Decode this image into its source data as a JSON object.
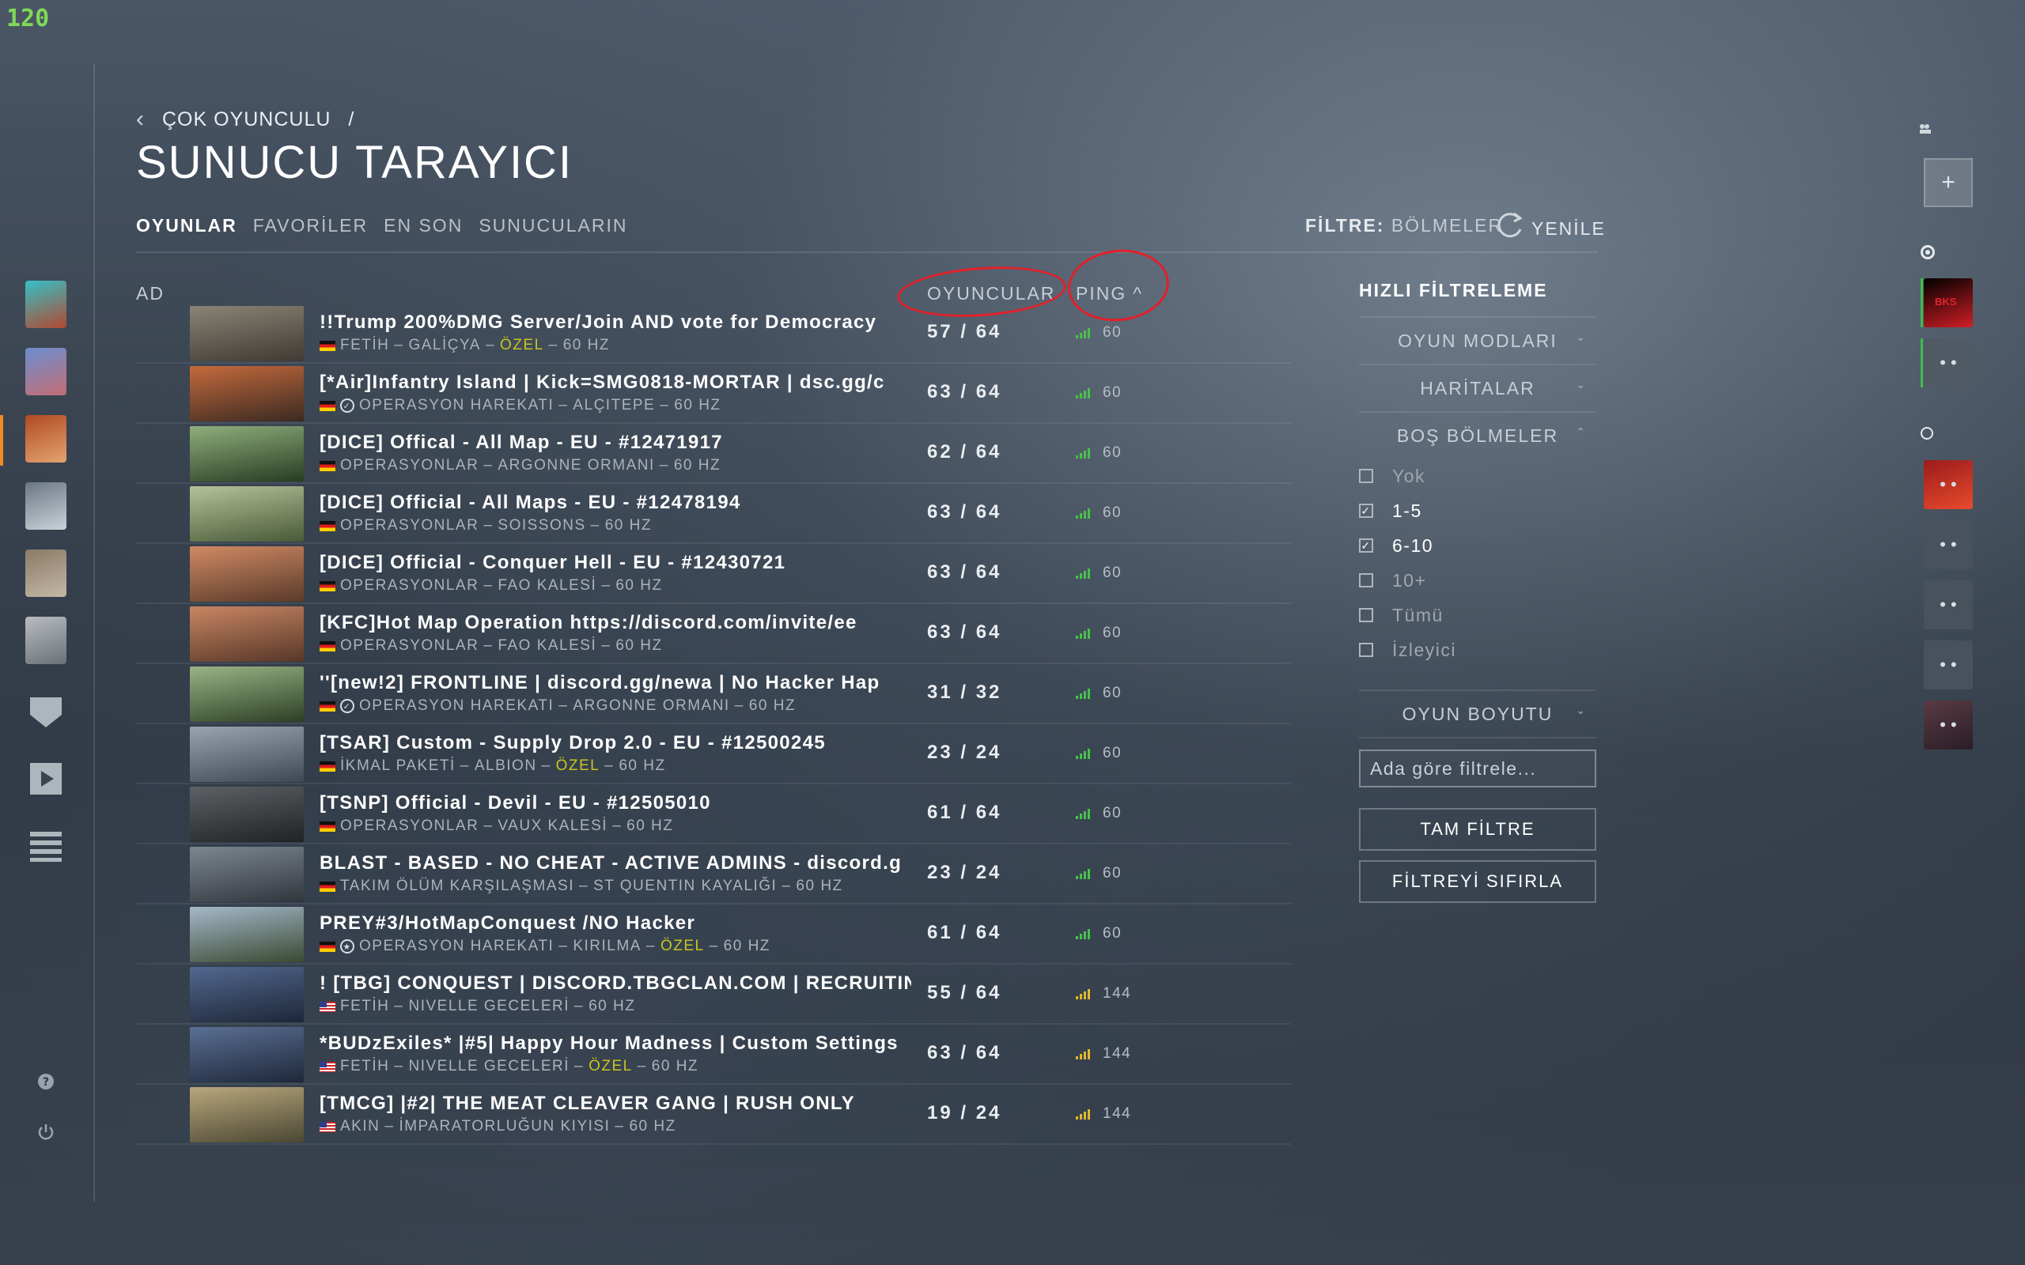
{
  "fps_counter": "120",
  "breadcrumb": {
    "parent": "ÇOK OYUNCULU",
    "separator": "/"
  },
  "page_title": "SUNUCU TARAYICI",
  "tabs": [
    "OYUNLAR",
    "FAVORİLER",
    "EN SON",
    "SUNUCULARIN"
  ],
  "filter": {
    "label": "FİLTRE:",
    "value": "BÖLMELER"
  },
  "refresh_label": "YENİLE",
  "columns": {
    "name": "AD",
    "players": "OYUNCULAR",
    "ping": "PING"
  },
  "servers": [
    {
      "name": "!!Trump 200%DMG Server/Join AND vote for Democracy",
      "flag": "de",
      "icon": "",
      "mode": "FETİH",
      "map": "GALİÇYA",
      "custom": "ÖZEL",
      "hz": "60 HZ",
      "players": "57 / 64",
      "ping": "60",
      "signal": "green",
      "colors": [
        "#8a8476",
        "#3f3a33"
      ]
    },
    {
      "name": "[*Air]Infantry Island | Kick=SMG0818-MORTAR | dsc.gg/c",
      "flag": "de",
      "icon": "check",
      "mode": "OPERASYON HAREKATI",
      "map": "ALÇITEPE",
      "custom": "",
      "hz": "60 HZ",
      "players": "63 / 64",
      "ping": "60",
      "signal": "green",
      "colors": [
        "#c46a3c",
        "#3b2a22"
      ]
    },
    {
      "name": "[DICE] Offical - All Map - EU - #12471917",
      "flag": "de",
      "icon": "",
      "mode": "OPERASYONLAR",
      "map": "ARGONNE ORMANI",
      "custom": "",
      "hz": "60 HZ",
      "players": "62 / 64",
      "ping": "60",
      "signal": "green",
      "colors": [
        "#8fae7d",
        "#283d22"
      ]
    },
    {
      "name": "[DICE] Official - All Maps - EU - #12478194",
      "flag": "de",
      "icon": "",
      "mode": "OPERASYONLAR",
      "map": "SOISSONS",
      "custom": "",
      "hz": "60 HZ",
      "players": "63 / 64",
      "ping": "60",
      "signal": "green",
      "colors": [
        "#b3c29a",
        "#4b5a37"
      ]
    },
    {
      "name": "[DICE] Official - Conquer Hell - EU - #12430721",
      "flag": "de",
      "icon": "",
      "mode": "OPERASYONLAR",
      "map": "FAO KALESİ",
      "custom": "",
      "hz": "60 HZ",
      "players": "63 / 64",
      "ping": "60",
      "signal": "green",
      "colors": [
        "#d08a63",
        "#5a3a2b"
      ]
    },
    {
      "name": "[KFC]Hot Map Operation https://discord.com/invite/ee",
      "flag": "de",
      "icon": "",
      "mode": "OPERASYONLAR",
      "map": "FAO KALESİ",
      "custom": "",
      "hz": "60 HZ",
      "players": "63 / 64",
      "ping": "60",
      "signal": "green",
      "colors": [
        "#c98662",
        "#573729"
      ]
    },
    {
      "name": "''[new!2] FRONTLINE | discord.gg/newa | No Hacker Hap",
      "flag": "de",
      "icon": "check",
      "mode": "OPERASYON HAREKATI",
      "map": "ARGONNE ORMANI",
      "custom": "",
      "hz": "60 HZ",
      "players": "31 / 32",
      "ping": "60",
      "signal": "green",
      "colors": [
        "#9ab487",
        "#2b4024"
      ]
    },
    {
      "name": "[TSAR] Custom - Supply Drop 2.0 - EU - #12500245",
      "flag": "de",
      "icon": "",
      "mode": "İKMAL PAKETİ",
      "map": "ALBION",
      "custom": "ÖZEL",
      "hz": "60 HZ",
      "players": "23 / 24",
      "ping": "60",
      "signal": "green",
      "colors": [
        "#9aa4b0",
        "#3f4852"
      ]
    },
    {
      "name": "[TSNP] Official - Devil - EU - #12505010",
      "flag": "de",
      "icon": "",
      "mode": "OPERASYONLAR",
      "map": "VAUX KALESİ",
      "custom": "",
      "hz": "60 HZ",
      "players": "61 / 64",
      "ping": "60",
      "signal": "green",
      "colors": [
        "#5d6165",
        "#1f2326"
      ]
    },
    {
      "name": "BLAST - BASED - NO CHEAT - ACTIVE ADMINS - discord.g",
      "flag": "de",
      "icon": "",
      "mode": "TAKIM ÖLÜM KARŞILAŞMASI",
      "map": "ST QUENTIN KAYALIĞI",
      "custom": "",
      "hz": "60 HZ",
      "players": "23 / 24",
      "ping": "60",
      "signal": "green",
      "colors": [
        "#7d8690",
        "#30363c"
      ]
    },
    {
      "name": "PREY#3/HotMapConquest /NO Hacker",
      "flag": "de",
      "icon": "star",
      "mode": "OPERASYON HAREKATI",
      "map": "KIRILMA",
      "custom": "ÖZEL",
      "hz": "60 HZ",
      "players": "61 / 64",
      "ping": "60",
      "signal": "green",
      "colors": [
        "#a5b8c9",
        "#3a4a33"
      ]
    },
    {
      "name": "! [TBG] CONQUEST | DISCORD.TBGCLAN.COM | RECRUITING!",
      "flag": "us",
      "icon": "",
      "mode": "FETİH",
      "map": "NIVELLE GECELERİ",
      "custom": "",
      "hz": "60 HZ",
      "players": "55 / 64",
      "ping": "144",
      "signal": "yellow",
      "colors": [
        "#52688e",
        "#1d2738"
      ]
    },
    {
      "name": "*BUDzExiles* |#5| Happy Hour Madness | Custom Settings",
      "flag": "us",
      "icon": "",
      "mode": "FETİH",
      "map": "NIVELLE GECELERİ",
      "custom": "ÖZEL",
      "hz": "60 HZ",
      "players": "63 / 64",
      "ping": "144",
      "signal": "yellow",
      "colors": [
        "#5a6f93",
        "#1e283a"
      ]
    },
    {
      "name": "[TMCG] |#2| THE MEAT CLEAVER GANG | RUSH ONLY",
      "flag": "us",
      "icon": "",
      "mode": "AKIN",
      "map": "İMPARATORLUĞUN KIYISI",
      "custom": "",
      "hz": "60 HZ",
      "players": "19 / 24",
      "ping": "144",
      "signal": "yellow",
      "colors": [
        "#b9a77d",
        "#4a4733"
      ]
    }
  ],
  "quick_filter": {
    "title": "HIZLI FİLTRELEME",
    "sections": {
      "modes": "OYUN MODLARI",
      "maps": "HARİTALAR",
      "empty_slots": "BOŞ BÖLMELER",
      "game_size": "OYUN BOYUTU"
    },
    "slot_options": [
      {
        "label": "Yok",
        "checked": false
      },
      {
        "label": "1-5",
        "checked": true
      },
      {
        "label": "6-10",
        "checked": true
      },
      {
        "label": "10+",
        "checked": false
      },
      {
        "label": "Tümü",
        "checked": false
      },
      {
        "label": "İzleyici",
        "checked": false
      }
    ],
    "search_placeholder": "Ada göre filtrele...",
    "full_filter_button": "TAM FİLTRE",
    "reset_button": "FİLTREYİ SIFIRLA"
  },
  "squad_slots": [
    {
      "label": "BKS",
      "online": true,
      "colors": [
        "#000000",
        "#d01e25"
      ]
    },
    {
      "label": "",
      "online": true,
      "colors": [
        "#505a64",
        "#505a64"
      ]
    },
    {
      "label": "",
      "online": false,
      "colors": [
        "#9b1c1c",
        "#e84a2c"
      ]
    },
    {
      "label": "",
      "online": false,
      "colors": [
        "#48525c",
        "#48525c"
      ]
    },
    {
      "label": "",
      "online": false,
      "colors": [
        "#48525c",
        "#48525c"
      ]
    },
    {
      "label": "",
      "online": false,
      "colors": [
        "#48525c",
        "#48525c"
      ]
    },
    {
      "label": "",
      "online": false,
      "colors": [
        "#5a3a44",
        "#2a1e26"
      ]
    }
  ],
  "left_nav_colors": [
    [
      "#35c0c8",
      "#b1492f"
    ],
    [
      "#6a8ed0",
      "#c36d74"
    ],
    [
      "#b04a24",
      "#e3a36e"
    ],
    [
      "#6a7784",
      "#cbd2d8"
    ],
    [
      "#8a7a66",
      "#c4b8a5"
    ],
    [
      "#b8bcc2",
      "#6b7178"
    ]
  ],
  "colors": {
    "accent_orange": "#f08a24",
    "highlight_yellow": "#c7c51f",
    "annotation_red": "#e2202a",
    "ping_green": "#47c24b",
    "ping_yellow": "#e3b72c"
  }
}
